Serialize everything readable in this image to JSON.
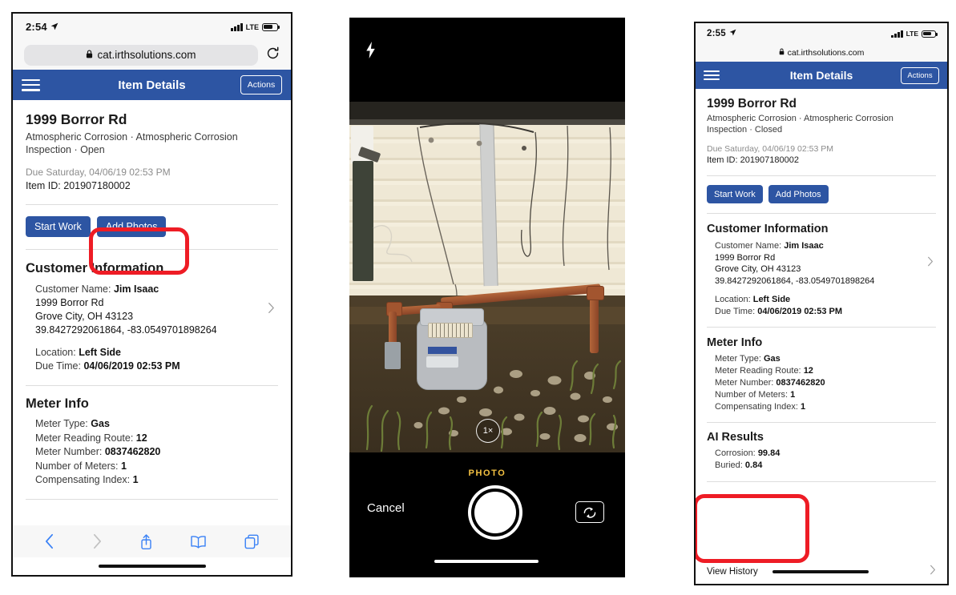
{
  "screens": [
    {
      "id": "left",
      "status": {
        "time": "2:54",
        "location_arrow": "location-arrow-icon",
        "carrier": "LTE",
        "signal": "signal-bars-icon",
        "battery": "battery-icon"
      },
      "browser": {
        "url": "cat.irthsolutions.com",
        "lock": "lock-icon",
        "reload": "reload-icon"
      },
      "nav": {
        "menu": "hamburger-menu-icon",
        "title": "Item Details",
        "actions_label": "Actions"
      },
      "item": {
        "address": "1999 Borror Rd",
        "subtitle": "Atmospheric Corrosion · Atmospheric Corrosion Inspection · Open",
        "due": "Due Saturday, 04/06/19 02:53 PM",
        "item_id_label": "Item ID:",
        "item_id_value": "201907180002"
      },
      "buttons": {
        "start_work": "Start Work",
        "add_photos": "Add Photos"
      },
      "customer": {
        "heading": "Customer Information",
        "name_label": "Customer Name:",
        "name_value": "Jim Isaac",
        "street": "1999 Borror Rd",
        "city": "Grove City, OH 43123",
        "coords": "39.8427292061864, -83.0549701898264",
        "location_label": "Location:",
        "location_value": "Left Side",
        "due_time_label": "Due Time:",
        "due_time_value": "04/06/2019 02:53 PM",
        "chevron": "chevron-right-icon"
      },
      "meter": {
        "heading": "Meter Info",
        "rows": [
          {
            "label": "Meter Type:",
            "value": "Gas"
          },
          {
            "label": "Meter Reading Route:",
            "value": "12"
          },
          {
            "label": "Meter Number:",
            "value": "0837462820"
          },
          {
            "label": "Number of Meters:",
            "value": "1"
          },
          {
            "label": "Compensating Index:",
            "value": "1"
          }
        ]
      },
      "toolbar": {
        "back": "back-chevron-icon",
        "forward": "forward-chevron-icon",
        "share": "share-icon",
        "bookmarks": "bookmarks-icon",
        "tabs": "tabs-icon"
      },
      "annotation": {
        "target": "Add Photos",
        "color": "#ee1c25"
      }
    },
    {
      "id": "middle",
      "camera": {
        "flash": "flash-icon",
        "zoom_level": "1×",
        "mode_label": "PHOTO",
        "cancel_label": "Cancel",
        "shutter": "shutter-button",
        "flip": "camera-flip-icon",
        "scene_description": "Gas meter with rusty pipes against cream vinyl siding"
      }
    },
    {
      "id": "right",
      "status": {
        "time": "2:55",
        "location_arrow": "location-arrow-icon",
        "carrier": "LTE",
        "signal": "signal-bars-icon",
        "battery": "battery-icon"
      },
      "browser": {
        "url": "cat.irthsolutions.com",
        "lock": "lock-icon"
      },
      "nav": {
        "menu": "hamburger-menu-icon",
        "title": "Item Details",
        "actions_label": "Actions"
      },
      "item": {
        "address": "1999 Borror Rd",
        "subtitle": "Atmospheric Corrosion · Atmospheric Corrosion Inspection · Closed",
        "due": "Due Saturday, 04/06/19 02:53 PM",
        "item_id_label": "Item ID:",
        "item_id_value": "201907180002"
      },
      "buttons": {
        "start_work": "Start Work",
        "add_photos": "Add Photos"
      },
      "customer": {
        "heading": "Customer Information",
        "name_label": "Customer Name:",
        "name_value": "Jim Isaac",
        "street": "1999 Borror Rd",
        "city": "Grove City, OH 43123",
        "coords": "39.8427292061864, -83.0549701898264",
        "location_label": "Location:",
        "location_value": "Left Side",
        "due_time_label": "Due Time:",
        "due_time_value": "04/06/2019 02:53 PM",
        "chevron": "chevron-right-icon"
      },
      "meter": {
        "heading": "Meter Info",
        "rows": [
          {
            "label": "Meter Type:",
            "value": "Gas"
          },
          {
            "label": "Meter Reading Route:",
            "value": "12"
          },
          {
            "label": "Meter Number:",
            "value": "0837462820"
          },
          {
            "label": "Number of Meters:",
            "value": "1"
          },
          {
            "label": "Compensating Index:",
            "value": "1"
          }
        ]
      },
      "ai": {
        "heading": "AI Results",
        "rows": [
          {
            "label": "Corrosion:",
            "value": "99.84"
          },
          {
            "label": "Buried:",
            "value": "0.84"
          }
        ]
      },
      "footer": {
        "view_history": "View History",
        "chevron": "chevron-right-icon"
      },
      "annotation": {
        "target": "AI Results",
        "color": "#ee1c25"
      }
    }
  ],
  "colors": {
    "brand_blue": "#2d55a3",
    "annotation_red": "#ee1c25",
    "ios_blue": "#3b82f6",
    "camera_yellow": "#f5c242"
  }
}
